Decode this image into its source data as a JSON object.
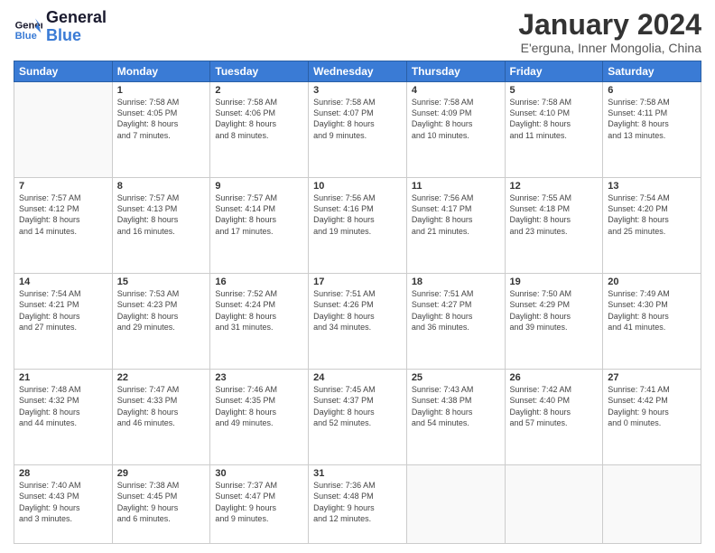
{
  "logo": {
    "line1": "General",
    "line2": "Blue"
  },
  "title": "January 2024",
  "subtitle": "E'erguna, Inner Mongolia, China",
  "days_of_week": [
    "Sunday",
    "Monday",
    "Tuesday",
    "Wednesday",
    "Thursday",
    "Friday",
    "Saturday"
  ],
  "weeks": [
    [
      {
        "day": null,
        "info": null
      },
      {
        "day": "1",
        "sunrise": "7:58 AM",
        "sunset": "4:05 PM",
        "daylight": "8 hours and 7 minutes."
      },
      {
        "day": "2",
        "sunrise": "7:58 AM",
        "sunset": "4:06 PM",
        "daylight": "8 hours and 8 minutes."
      },
      {
        "day": "3",
        "sunrise": "7:58 AM",
        "sunset": "4:07 PM",
        "daylight": "8 hours and 9 minutes."
      },
      {
        "day": "4",
        "sunrise": "7:58 AM",
        "sunset": "4:09 PM",
        "daylight": "8 hours and 10 minutes."
      },
      {
        "day": "5",
        "sunrise": "7:58 AM",
        "sunset": "4:10 PM",
        "daylight": "8 hours and 11 minutes."
      },
      {
        "day": "6",
        "sunrise": "7:58 AM",
        "sunset": "4:11 PM",
        "daylight": "8 hours and 13 minutes."
      }
    ],
    [
      {
        "day": "7",
        "sunrise": "7:57 AM",
        "sunset": "4:12 PM",
        "daylight": "8 hours and 14 minutes."
      },
      {
        "day": "8",
        "sunrise": "7:57 AM",
        "sunset": "4:13 PM",
        "daylight": "8 hours and 16 minutes."
      },
      {
        "day": "9",
        "sunrise": "7:57 AM",
        "sunset": "4:14 PM",
        "daylight": "8 hours and 17 minutes."
      },
      {
        "day": "10",
        "sunrise": "7:56 AM",
        "sunset": "4:16 PM",
        "daylight": "8 hours and 19 minutes."
      },
      {
        "day": "11",
        "sunrise": "7:56 AM",
        "sunset": "4:17 PM",
        "daylight": "8 hours and 21 minutes."
      },
      {
        "day": "12",
        "sunrise": "7:55 AM",
        "sunset": "4:18 PM",
        "daylight": "8 hours and 23 minutes."
      },
      {
        "day": "13",
        "sunrise": "7:54 AM",
        "sunset": "4:20 PM",
        "daylight": "8 hours and 25 minutes."
      }
    ],
    [
      {
        "day": "14",
        "sunrise": "7:54 AM",
        "sunset": "4:21 PM",
        "daylight": "8 hours and 27 minutes."
      },
      {
        "day": "15",
        "sunrise": "7:53 AM",
        "sunset": "4:23 PM",
        "daylight": "8 hours and 29 minutes."
      },
      {
        "day": "16",
        "sunrise": "7:52 AM",
        "sunset": "4:24 PM",
        "daylight": "8 hours and 31 minutes."
      },
      {
        "day": "17",
        "sunrise": "7:51 AM",
        "sunset": "4:26 PM",
        "daylight": "8 hours and 34 minutes."
      },
      {
        "day": "18",
        "sunrise": "7:51 AM",
        "sunset": "4:27 PM",
        "daylight": "8 hours and 36 minutes."
      },
      {
        "day": "19",
        "sunrise": "7:50 AM",
        "sunset": "4:29 PM",
        "daylight": "8 hours and 39 minutes."
      },
      {
        "day": "20",
        "sunrise": "7:49 AM",
        "sunset": "4:30 PM",
        "daylight": "8 hours and 41 minutes."
      }
    ],
    [
      {
        "day": "21",
        "sunrise": "7:48 AM",
        "sunset": "4:32 PM",
        "daylight": "8 hours and 44 minutes."
      },
      {
        "day": "22",
        "sunrise": "7:47 AM",
        "sunset": "4:33 PM",
        "daylight": "8 hours and 46 minutes."
      },
      {
        "day": "23",
        "sunrise": "7:46 AM",
        "sunset": "4:35 PM",
        "daylight": "8 hours and 49 minutes."
      },
      {
        "day": "24",
        "sunrise": "7:45 AM",
        "sunset": "4:37 PM",
        "daylight": "8 hours and 52 minutes."
      },
      {
        "day": "25",
        "sunrise": "7:43 AM",
        "sunset": "4:38 PM",
        "daylight": "8 hours and 54 minutes."
      },
      {
        "day": "26",
        "sunrise": "7:42 AM",
        "sunset": "4:40 PM",
        "daylight": "8 hours and 57 minutes."
      },
      {
        "day": "27",
        "sunrise": "7:41 AM",
        "sunset": "4:42 PM",
        "daylight": "9 hours and 0 minutes."
      }
    ],
    [
      {
        "day": "28",
        "sunrise": "7:40 AM",
        "sunset": "4:43 PM",
        "daylight": "9 hours and 3 minutes."
      },
      {
        "day": "29",
        "sunrise": "7:38 AM",
        "sunset": "4:45 PM",
        "daylight": "9 hours and 6 minutes."
      },
      {
        "day": "30",
        "sunrise": "7:37 AM",
        "sunset": "4:47 PM",
        "daylight": "9 hours and 9 minutes."
      },
      {
        "day": "31",
        "sunrise": "7:36 AM",
        "sunset": "4:48 PM",
        "daylight": "9 hours and 12 minutes."
      },
      {
        "day": null,
        "info": null
      },
      {
        "day": null,
        "info": null
      },
      {
        "day": null,
        "info": null
      }
    ]
  ]
}
